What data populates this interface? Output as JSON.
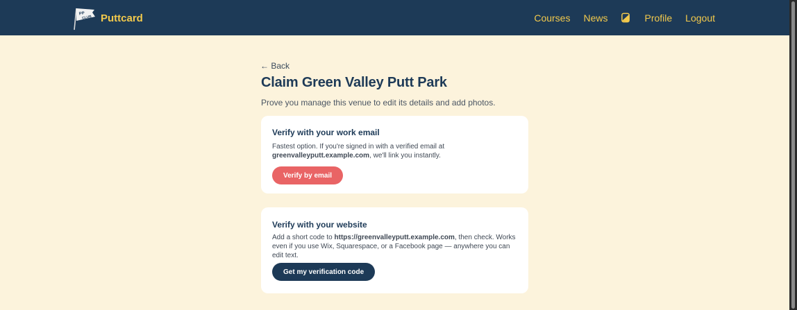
{
  "nav": {
    "brand_name": "Puttcard",
    "links": {
      "courses": "Courses",
      "news": "News",
      "profile": "Profile",
      "logout": "Logout"
    },
    "theme_icon": "theme-toggle-icon"
  },
  "page": {
    "back_label": "← Back",
    "title": "Claim Green Valley Putt Park",
    "subtitle": "Prove you manage this venue to edit its details and add photos."
  },
  "email_card": {
    "heading": "Verify with your work email",
    "text_before": "Fastest option. If you're signed in with a verified email at",
    "domain": "greenvalleyputt.example.com",
    "text_after": ", we'll link you instantly.",
    "button_label": "Verify by email"
  },
  "website_card": {
    "heading": "Verify with your website",
    "text_before": "Add a short code to ",
    "url": "https://greenvalleyputt.example.com",
    "text_after": ", then check. Works even if you use Wix, Squarespace, or a Facebook page — anywhere you can edit text.",
    "button_label": "Get my verification code"
  },
  "colors": {
    "navbar": "#1d3a57",
    "accent_yellow": "#f2c94c",
    "background": "#fcf3dc",
    "primary_red": "#e96465",
    "navy": "#1d3a57"
  }
}
